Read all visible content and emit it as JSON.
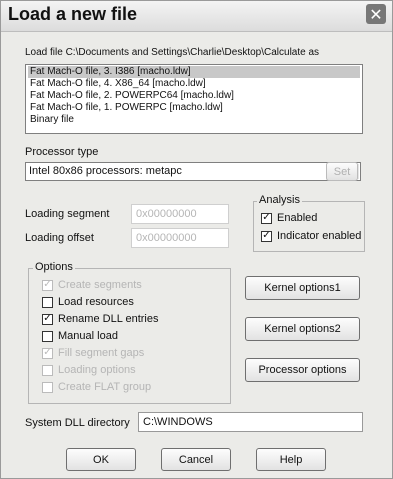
{
  "dialog": {
    "title": "Load a new file",
    "close_glyph": "✕"
  },
  "load_file": {
    "label": "Load file C:\\Documents and Settings\\Charlie\\Desktop\\Calculate as",
    "items": [
      {
        "text": "Fat Mach-O file, 3. I386 [macho.ldw]",
        "selected": true
      },
      {
        "text": "Fat Mach-O file, 4. X86_64 [macho.ldw]",
        "selected": false
      },
      {
        "text": "Fat Mach-O file, 2. POWERPC64 [macho.ldw]",
        "selected": false
      },
      {
        "text": "Fat Mach-O file, 1. POWERPC [macho.ldw]",
        "selected": false
      },
      {
        "text": "Binary file",
        "selected": false
      }
    ]
  },
  "processor": {
    "label": "Processor type",
    "value": "Intel 80x86 processors: metapc",
    "dropdown_icon": "chevron-down-icon",
    "set_label": "Set"
  },
  "loading": {
    "segment_label": "Loading segment",
    "segment_value": "0x00000000",
    "offset_label": "Loading offset",
    "offset_value": "0x00000000"
  },
  "analysis": {
    "title": "Analysis",
    "enabled_label": "Enabled",
    "enabled_checked": true,
    "indicator_label": "Indicator enabled",
    "indicator_checked": true
  },
  "options": {
    "title": "Options",
    "items": [
      {
        "label": "Create segments",
        "checked": true,
        "disabled": true
      },
      {
        "label": "Load resources",
        "checked": false,
        "disabled": false
      },
      {
        "label": "Rename DLL entries",
        "checked": true,
        "disabled": false
      },
      {
        "label": "Manual load",
        "checked": false,
        "disabled": false
      },
      {
        "label": "Fill segment gaps",
        "checked": true,
        "disabled": true
      },
      {
        "label": "Loading options",
        "checked": false,
        "disabled": true
      },
      {
        "label": "Create FLAT group",
        "checked": false,
        "disabled": true
      }
    ]
  },
  "buttons": {
    "kernel1": "Kernel options1",
    "kernel2": "Kernel options2",
    "processor_options": "Processor options",
    "ok": "OK",
    "cancel": "Cancel",
    "help": "Help"
  },
  "system_dll": {
    "label": "System DLL directory",
    "value": "C:\\WINDOWS"
  },
  "colors": {
    "dialog_bg": "#ebebe8",
    "selection": "#c8c8c8",
    "disabled_text": "#b5b5b5"
  }
}
